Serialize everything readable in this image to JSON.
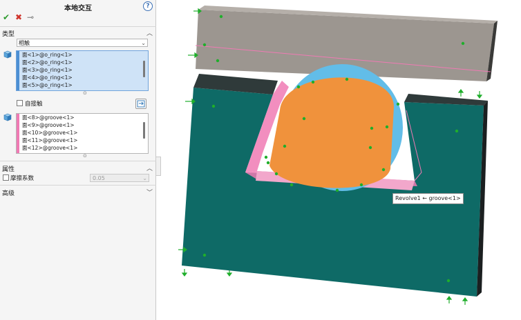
{
  "panel": {
    "title": "本地交互",
    "help_glyph": "?",
    "toolbar": {
      "ok_glyph": "✔",
      "cancel_glyph": "✖",
      "pin_glyph": "⊸"
    },
    "type_section": {
      "label": "类型",
      "interaction_type": "相触",
      "set1_items": [
        "面<1>@o_ring<1>",
        "面<2>@o_ring<1>",
        "面<3>@o_ring<1>",
        "面<4>@o_ring<1>",
        "面<5>@o_ring<1>"
      ],
      "self_contact_label": "自接触",
      "set2_items": [
        "面<8>@groove<1>",
        "面<9>@groove<1>",
        "面<10>@groove<1>",
        "面<11>@groove<1>",
        "面<12>@groove<1>"
      ]
    },
    "properties_section": {
      "label": "属性",
      "friction_label": "摩擦系数",
      "friction_value": "0.05"
    },
    "advanced_section": {
      "label": "高级"
    }
  },
  "viewport": {
    "tooltip": "Revolve1 ← groove<1>"
  },
  "colors": {
    "groove_face": "#0e6a66",
    "groove_side": "#1b1f20",
    "top_block": "#9c9690",
    "o_ring": "#f0923c",
    "o_ring_shadow": "#62bde8",
    "highlight": "#f07ab4",
    "handle": "#1fae2b"
  }
}
